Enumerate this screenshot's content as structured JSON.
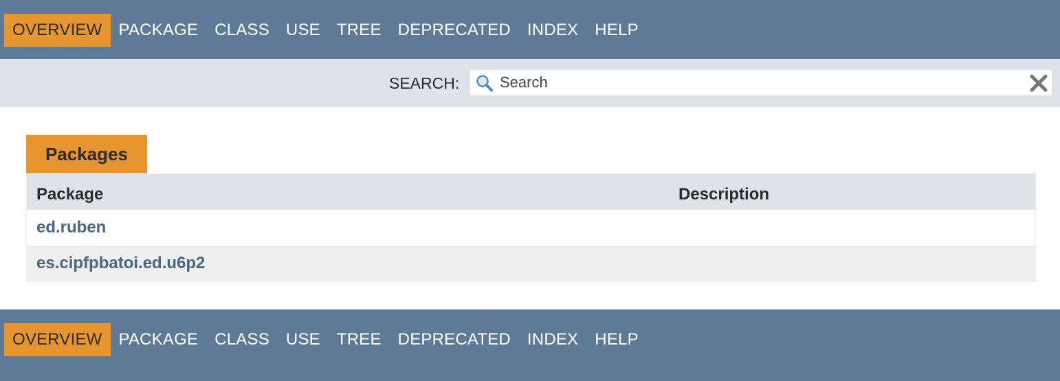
{
  "nav": {
    "items": [
      {
        "label": "OVERVIEW",
        "active": true
      },
      {
        "label": "PACKAGE",
        "active": false
      },
      {
        "label": "CLASS",
        "active": false
      },
      {
        "label": "USE",
        "active": false
      },
      {
        "label": "TREE",
        "active": false
      },
      {
        "label": "DEPRECATED",
        "active": false
      },
      {
        "label": "INDEX",
        "active": false
      },
      {
        "label": "HELP",
        "active": false
      }
    ]
  },
  "search": {
    "label": "SEARCH:",
    "placeholder": "Search",
    "value": "",
    "icon": "search-icon",
    "reset_icon": "close-icon"
  },
  "packages": {
    "caption": "Packages",
    "columns": [
      "Package",
      "Description"
    ],
    "rows": [
      {
        "name": "ed.ruben",
        "description": ""
      },
      {
        "name": "es.cipfpbatoi.ed.u6p2",
        "description": ""
      }
    ]
  },
  "colors": {
    "nav_bg": "#5e7a96",
    "accent": "#e7962f",
    "subnav_bg": "#dee3e9",
    "link": "#4a6782",
    "row_alt": "#eeeeef"
  }
}
